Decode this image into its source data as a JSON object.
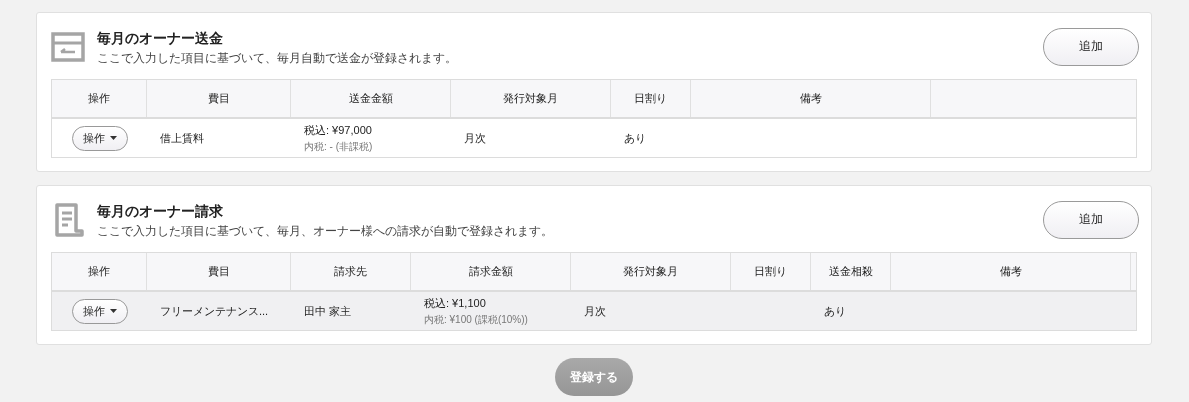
{
  "sections": [
    {
      "title": "毎月のオーナー送金",
      "description": "ここで入力した項目に基づいて、毎月自動で送金が登録されます。",
      "add_button": "追加",
      "columns": [
        "操作",
        "費目",
        "送金金額",
        "発行対象月",
        "日割り",
        "備考"
      ],
      "rows": [
        {
          "highlighted": false,
          "cells": [
            {
              "kind": "action",
              "label": "操作"
            },
            {
              "kind": "text",
              "text": "借上賃料"
            },
            {
              "kind": "amount",
              "main": "税込: ¥97,000",
              "sub": "内税: - (非課税)"
            },
            {
              "kind": "text",
              "text": "月次"
            },
            {
              "kind": "text",
              "text": "あり"
            },
            {
              "kind": "empty"
            }
          ]
        }
      ]
    },
    {
      "title": "毎月のオーナー請求",
      "description": "ここで入力した項目に基づいて、毎月、オーナー様への請求が自動で登録されます。",
      "add_button": "追加",
      "columns": [
        "操作",
        "費目",
        "請求先",
        "請求金額",
        "発行対象月",
        "日割り",
        "送金相殺",
        "備考"
      ],
      "rows": [
        {
          "highlighted": true,
          "cells": [
            {
              "kind": "action",
              "label": "操作"
            },
            {
              "kind": "text",
              "text": "フリーメンテナンス..."
            },
            {
              "kind": "text",
              "text": "田中 家主"
            },
            {
              "kind": "amount",
              "main": "税込: ¥1,100",
              "sub": "内税: ¥100 (課税(10%))"
            },
            {
              "kind": "text",
              "text": "月次"
            },
            {
              "kind": "empty"
            },
            {
              "kind": "text",
              "text": "あり"
            },
            {
              "kind": "empty"
            }
          ]
        }
      ]
    }
  ],
  "submit_button": {
    "label": "登録する",
    "disabled": true
  }
}
